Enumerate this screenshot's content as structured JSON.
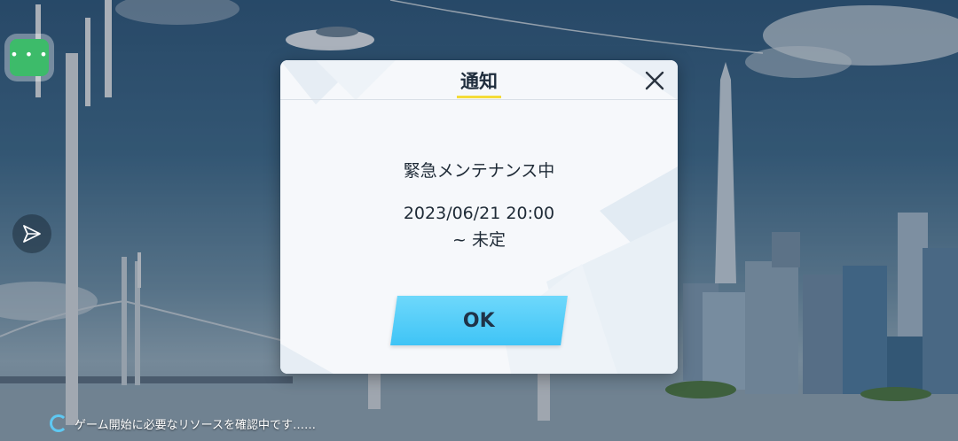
{
  "dialog": {
    "title": "通知",
    "message_line1": "緊急メンテナンス中",
    "message_line2": "2023/06/21 20:00",
    "message_line3": "~ 未定",
    "ok_label": "OK"
  },
  "status": {
    "loading_text": "ゲーム開始に必要なリソースを確認中です……"
  },
  "icons": {
    "menu": "more-dots-icon",
    "side": "send-icon",
    "close": "close-icon",
    "loading": "spinner-icon"
  },
  "colors": {
    "accent_green": "#3dbb6a",
    "ok_button": "#4fcbf8",
    "title_underline": "#f4dc3a"
  }
}
